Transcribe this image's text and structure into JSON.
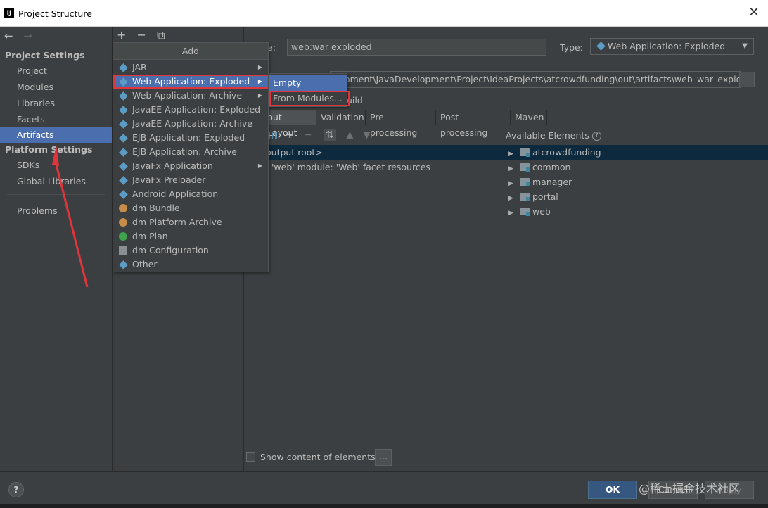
{
  "window": {
    "title": "Project Structure",
    "app_icon": "IJ",
    "close_glyph": "✕"
  },
  "sidebar": {
    "back_glyph": "←",
    "forward_glyph": "→",
    "project_settings_heading": "Project Settings",
    "project_items": [
      "Project",
      "Modules",
      "Libraries",
      "Facets",
      "Artifacts"
    ],
    "selected_item": "Artifacts",
    "platform_settings_heading": "Platform Settings",
    "platform_items": [
      "SDKs",
      "Global Libraries"
    ],
    "problems": "Problems"
  },
  "artifacts_toolbar": {
    "add_glyph": "+",
    "remove_glyph": "−",
    "copy_glyph": "⧉"
  },
  "config": {
    "name_label": "Name:",
    "name_label_visible": "e:",
    "name_value": "web:war exploded",
    "type_label": "Type:",
    "type_value": "Web Application: Exploded",
    "output_dir_value": "opment\\JavaDevelopment\\Project\\IdeaProjects\\atcrowdfunding\\out\\artifacts\\web_war_exploded",
    "build_fragment": "uild",
    "tabs": [
      "put Layout",
      "Validation",
      "Pre-processing",
      "Post-processing",
      "Maven"
    ],
    "active_tab": "put Layout",
    "available_elements_label": "Available Elements",
    "output_tree": [
      "output root>",
      "'web' module: 'Web' facet resources"
    ],
    "available_tree": [
      "atcrowdfunding",
      "common",
      "manager",
      "portal",
      "web"
    ],
    "show_content_label": "Show content of elements",
    "dots_label": "..."
  },
  "add_menu": {
    "title": "Add",
    "items": [
      {
        "label": "JAR",
        "icon": "jar-icon",
        "submenu": true
      },
      {
        "label": "Web Application: Exploded",
        "icon": "web-app-icon",
        "submenu": true,
        "selected": true
      },
      {
        "label": "Web Application: Archive",
        "icon": "web-app-icon",
        "submenu": true
      },
      {
        "label": "JavaEE Application: Exploded",
        "icon": "javaee-icon",
        "submenu": false
      },
      {
        "label": "JavaEE Application: Archive",
        "icon": "javaee-icon",
        "submenu": false
      },
      {
        "label": "EJB Application: Exploded",
        "icon": "ejb-icon",
        "submenu": false
      },
      {
        "label": "EJB Application: Archive",
        "icon": "ejb-icon",
        "submenu": false
      },
      {
        "label": "JavaFx Application",
        "icon": "javafx-icon",
        "submenu": true
      },
      {
        "label": "JavaFx Preloader",
        "icon": "javafx-icon",
        "submenu": false
      },
      {
        "label": "Android Application",
        "icon": "android-icon",
        "submenu": false
      },
      {
        "label": "dm Bundle",
        "icon": "dm-bundle-icon",
        "submenu": false
      },
      {
        "label": "dm Platform Archive",
        "icon": "dm-platform-icon",
        "submenu": false
      },
      {
        "label": "dm Plan",
        "icon": "dm-plan-icon",
        "submenu": false
      },
      {
        "label": "dm Configuration",
        "icon": "dm-config-icon",
        "submenu": false
      },
      {
        "label": "Other",
        "icon": "other-icon",
        "submenu": false
      }
    ]
  },
  "submenu": {
    "items": [
      "Empty",
      "From Modules..."
    ],
    "selected": "Empty",
    "highlighted": "From Modules..."
  },
  "buttons": {
    "help": "?",
    "ok": "OK",
    "cancel": "Cancel",
    "apply": "Apply"
  },
  "watermark": "@稀土掘金技术社区",
  "colors": {
    "selection": "#4b6eaf",
    "annotation_red": "#e0353b",
    "ok_button": "#365880"
  }
}
